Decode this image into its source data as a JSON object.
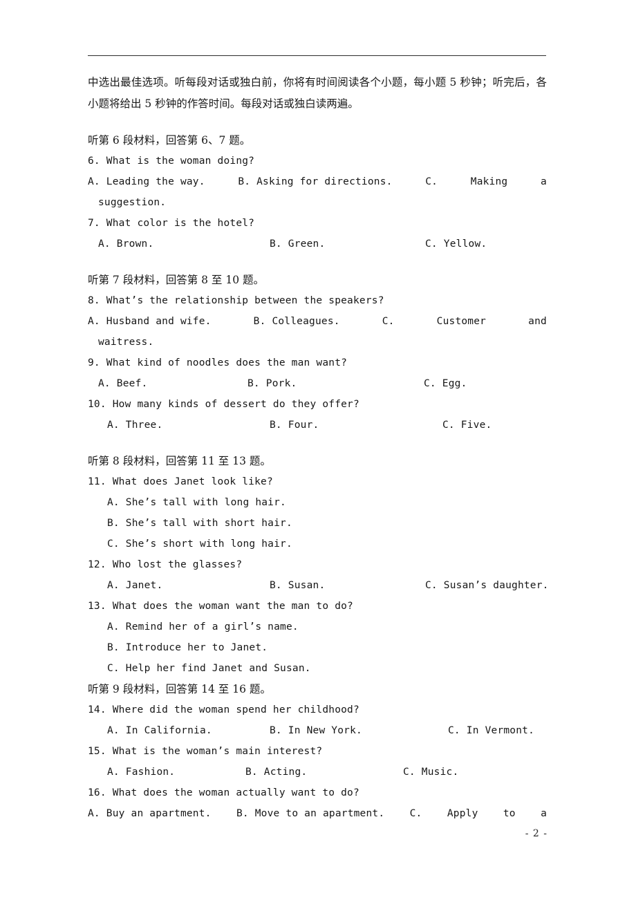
{
  "page": {
    "footer_page_number": "- 2 -"
  },
  "intro": {
    "paragraph": "中选出最佳选项。听每段对话或独白前，你将有时间阅读各个小题，每小题 5 秒钟；听完后，各小题将给出 5 秒钟的作答时间。每段对话或独白读两遍。"
  },
  "sections": [
    {
      "heading": "听第 6 段材料，回答第 6、7 题。",
      "questions": [
        {
          "number": "6.",
          "stem": "6. What is the woman doing?",
          "layout": "justified-wrap",
          "options": [
            "A. Leading the way.",
            "B. Asking for directions.",
            "C.",
            "Making",
            "a"
          ],
          "continuation": "suggestion."
        },
        {
          "number": "7.",
          "stem": "7. What color is the hotel?",
          "layout": "columns",
          "options": [
            "A. Brown.",
            "B. Green.",
            "C. Yellow."
          ],
          "columns": [
            142,
            390,
            615
          ]
        }
      ]
    },
    {
      "heading": "听第 7 段材料，回答第 8 至 10 题。",
      "questions": [
        {
          "number": "8.",
          "stem": "8. What’s the relationship between the speakers?",
          "layout": "justified-wrap",
          "options": [
            "A. Husband and wife.",
            "B. Colleagues.",
            "C.",
            "Customer",
            "and"
          ],
          "continuation": "waitress."
        },
        {
          "number": "9.",
          "stem": "9. What kind of noodles does the man want?",
          "layout": "columns",
          "options": [
            "A. Beef.",
            "B. Pork.",
            "C. Egg."
          ],
          "columns": [
            142,
            358,
            613
          ]
        },
        {
          "number": "10.",
          "stem": "10. How many kinds of dessert do they offer?",
          "layout": "columns",
          "options": [
            "A. Three.",
            "B. Four.",
            "C. Five."
          ],
          "columns": [
            155,
            390,
            640
          ]
        }
      ]
    },
    {
      "heading": "听第 8 段材料，回答第 11 至 13 题。",
      "questions": [
        {
          "number": "11.",
          "stem": "11. What does Janet look like?",
          "layout": "stacked",
          "options": [
            "A. She’s tall with long hair.",
            "B. She’s tall with short hair.",
            "C. She’s short with long hair."
          ]
        },
        {
          "number": "12.",
          "stem": "12. Who lost the glasses?",
          "layout": "columns",
          "options": [
            "A. Janet.",
            "B. Susan.",
            "C. Susan’s daughter."
          ],
          "columns": [
            155,
            390,
            615
          ]
        },
        {
          "number": "13.",
          "stem": "13. What does the woman want the man to do?",
          "layout": "stacked",
          "options": [
            "A. Remind her of a girl’s name.",
            "B. Introduce her to Janet.",
            "C. Help her find Janet and Susan."
          ]
        }
      ]
    },
    {
      "heading": "听第 9 段材料，回答第 14 至 16 题。",
      "questions": [
        {
          "number": "14.",
          "stem": "14. Where did the woman spend her childhood?",
          "layout": "columns",
          "options": [
            "A. In California.",
            "B. In New York.",
            "C. In Vermont."
          ],
          "columns": [
            155,
            390,
            648
          ]
        },
        {
          "number": "15.",
          "stem": "15. What is the woman’s main interest?",
          "layout": "columns",
          "options": [
            "A. Fashion.",
            "B. Acting.",
            "C. Music."
          ],
          "columns": [
            155,
            355,
            583
          ]
        },
        {
          "number": "16.",
          "stem": "16. What does the woman actually want to do?",
          "layout": "justified-wrap",
          "options": [
            "A. Buy an apartment.",
            "B. Move to an apartment.",
            "C.",
            "Apply",
            "to",
            "a"
          ],
          "continuation": ""
        }
      ]
    }
  ]
}
